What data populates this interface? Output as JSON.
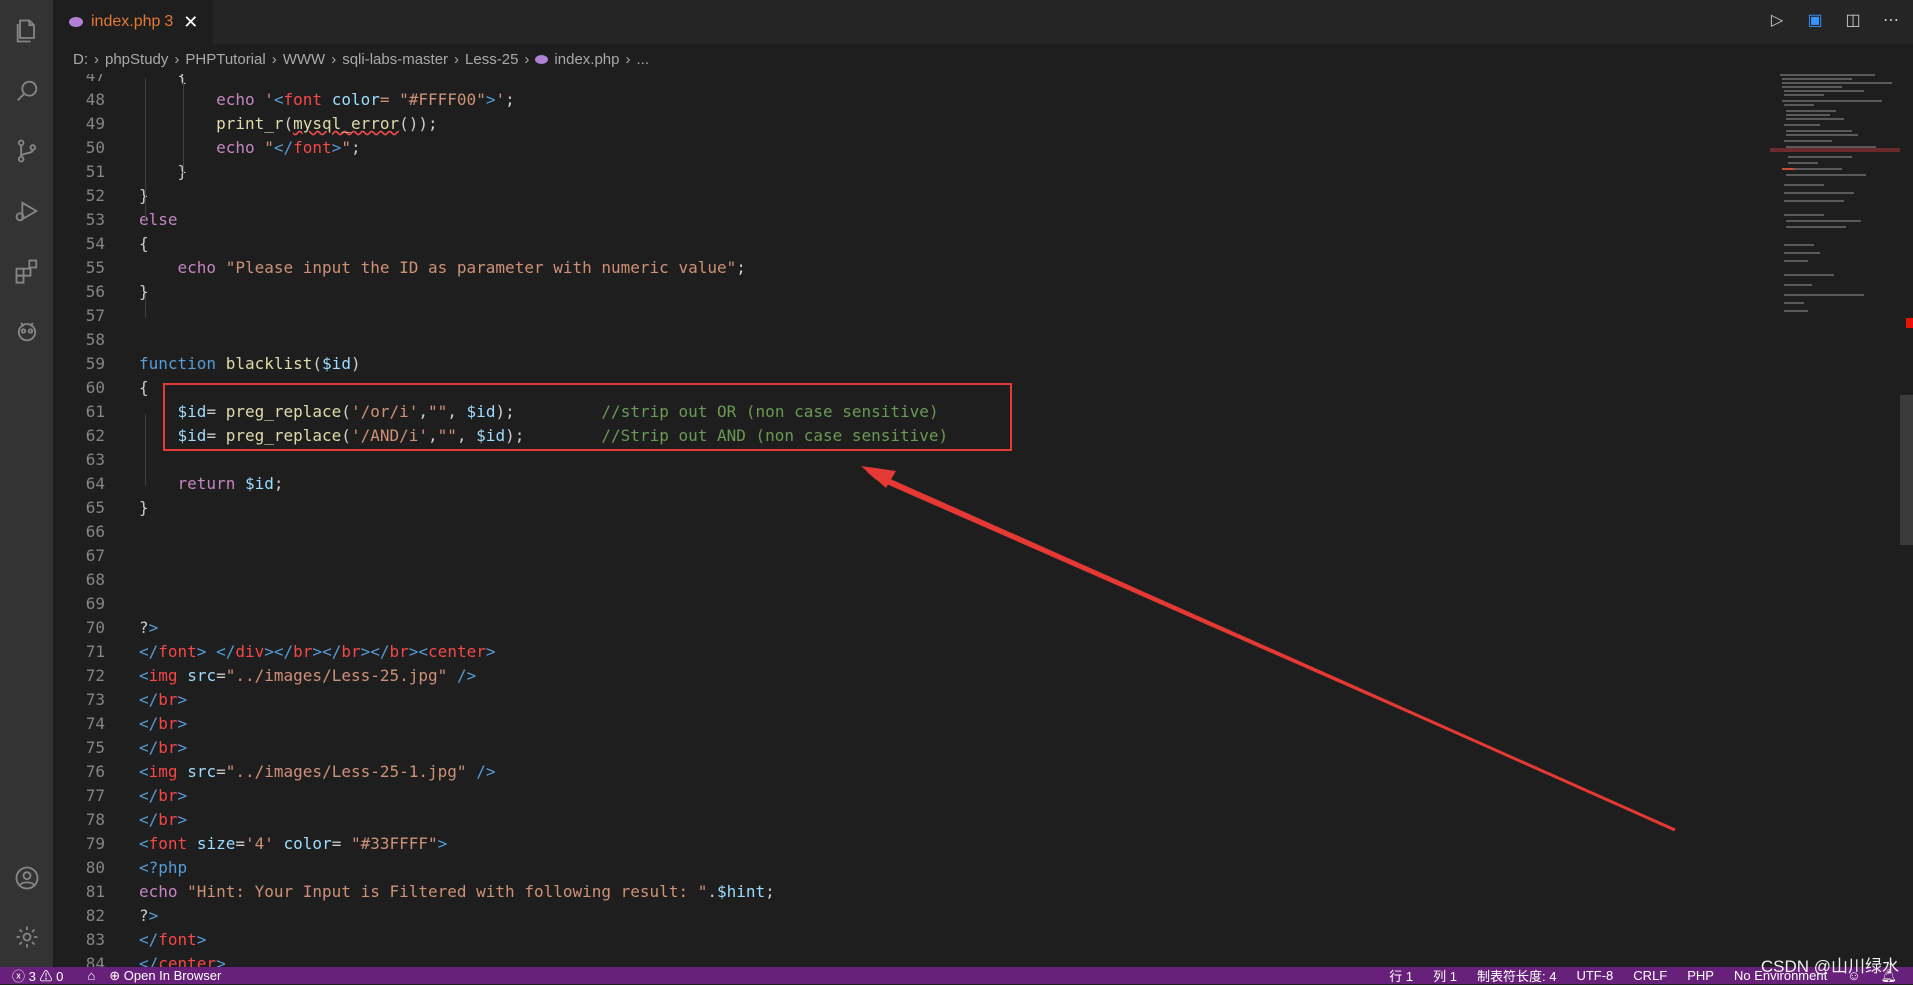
{
  "tab": {
    "title": "index.php",
    "problems": "3",
    "close": "✕"
  },
  "breadcrumb": [
    "D:",
    "phpStudy",
    "PHPTutorial",
    "WWW",
    "sqli-labs-master",
    "Less-25",
    "index.php",
    "..."
  ],
  "code_lines": [
    {
      "n": "47",
      "text": "    {"
    },
    {
      "n": "48",
      "text": "        echo '<font color= \"#FFFF00\">';"
    },
    {
      "n": "49",
      "text": "        print_r(mysql_error());"
    },
    {
      "n": "50",
      "text": "        echo \"</font>\";"
    },
    {
      "n": "51",
      "text": "    }"
    },
    {
      "n": "52",
      "text": "}"
    },
    {
      "n": "53",
      "text": "else"
    },
    {
      "n": "54",
      "text": "{"
    },
    {
      "n": "55",
      "text": "    echo \"Please input the ID as parameter with numeric value\";"
    },
    {
      "n": "56",
      "text": "}"
    },
    {
      "n": "57",
      "text": ""
    },
    {
      "n": "58",
      "text": ""
    },
    {
      "n": "59",
      "text": "function blacklist($id)"
    },
    {
      "n": "60",
      "text": "{"
    },
    {
      "n": "61",
      "text": "    $id= preg_replace('/or/i',\"\", $id);         //strip out OR (non case sensitive)"
    },
    {
      "n": "62",
      "text": "    $id= preg_replace('/AND/i',\"\", $id);        //Strip out AND (non case sensitive)"
    },
    {
      "n": "63",
      "text": ""
    },
    {
      "n": "64",
      "text": "    return $id;"
    },
    {
      "n": "65",
      "text": "}"
    },
    {
      "n": "66",
      "text": ""
    },
    {
      "n": "67",
      "text": ""
    },
    {
      "n": "68",
      "text": ""
    },
    {
      "n": "69",
      "text": ""
    },
    {
      "n": "70",
      "text": "?>"
    },
    {
      "n": "71",
      "text": "</font> </div></br></br></br><center>"
    },
    {
      "n": "72",
      "text": "<img src=\"../images/Less-25.jpg\" />"
    },
    {
      "n": "73",
      "text": "</br>"
    },
    {
      "n": "74",
      "text": "</br>"
    },
    {
      "n": "75",
      "text": "</br>"
    },
    {
      "n": "76",
      "text": "<img src=\"../images/Less-25-1.jpg\" />"
    },
    {
      "n": "77",
      "text": "</br>"
    },
    {
      "n": "78",
      "text": "</br>"
    },
    {
      "n": "79",
      "text": "<font size='4' color= \"#33FFFF\">"
    },
    {
      "n": "80",
      "text": "<?php"
    },
    {
      "n": "81",
      "text": "echo \"Hint: Your Input is Filtered with following result: \".$hint;"
    },
    {
      "n": "82",
      "text": "?>"
    },
    {
      "n": "83",
      "text": "</font>"
    },
    {
      "n": "84",
      "text": "</center>"
    }
  ],
  "statusbar": {
    "errors": "3",
    "warnings": "0",
    "open_in_browser": "Open In Browser",
    "line": "行 1",
    "col": "列 1",
    "tab_size": "制表符长度: 4",
    "encoding": "UTF-8",
    "eol": "CRLF",
    "language": "PHP",
    "environment": "No Environment"
  },
  "watermark": "CSDN @山川绿水",
  "colors": {
    "statusbar": "#68217a",
    "highlight_box": "#e53935",
    "editor_bg": "#1e1e1e"
  }
}
